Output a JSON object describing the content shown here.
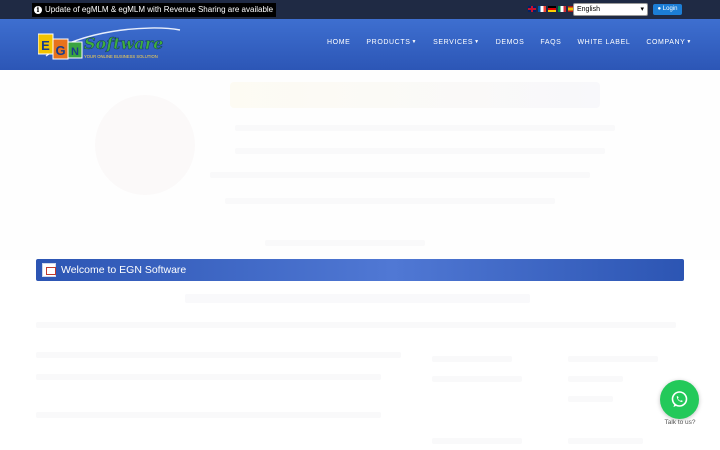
{
  "announcement": {
    "text": "Update of egMLM & egMLM with Revenue Sharing are available"
  },
  "language": {
    "flags": [
      "gb-flag",
      "fr-flag",
      "de-flag",
      "it-flag",
      "es-flag"
    ],
    "selected": "English"
  },
  "login": {
    "label": "Login"
  },
  "logo": {
    "main": "Software",
    "tagline": "YOUR ONLINE BUSINESS SOLUTION",
    "e": "E",
    "g": "G",
    "n": "N"
  },
  "nav": {
    "items": [
      {
        "label": "HOME",
        "dropdown": false
      },
      {
        "label": "PRODUCTS",
        "dropdown": true
      },
      {
        "label": "SERVICES",
        "dropdown": true
      },
      {
        "label": "DEMOS",
        "dropdown": false
      },
      {
        "label": "FAQS",
        "dropdown": false
      },
      {
        "label": "WHITE LABEL",
        "dropdown": false
      },
      {
        "label": "COMPANY",
        "dropdown": true
      }
    ]
  },
  "welcome": {
    "title": "Welcome to EGN Software"
  },
  "chat": {
    "label": "Talk to us?"
  },
  "colors": {
    "topbar": "#1f2a44",
    "header": "#3e6fd0",
    "accent": "#1c7ed6",
    "chat": "#23c95a"
  }
}
